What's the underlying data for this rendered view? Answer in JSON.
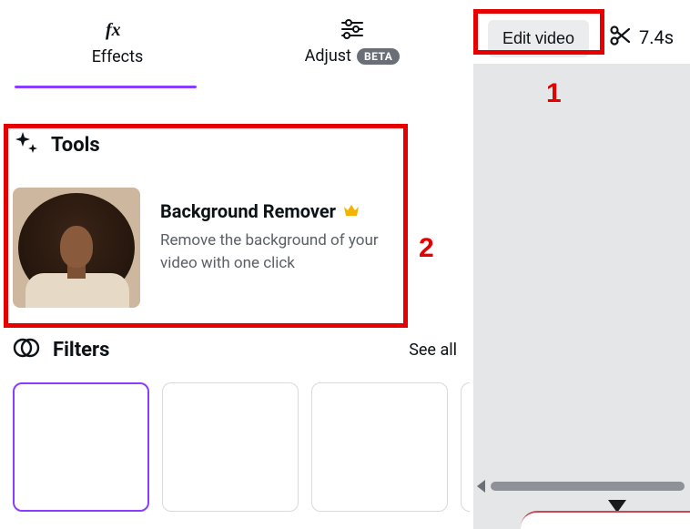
{
  "tabs": {
    "effects": {
      "label": "Effects"
    },
    "adjust": {
      "label": "Adjust",
      "badge": "BETA"
    }
  },
  "tools": {
    "section_title": "Tools",
    "bg_remover": {
      "title": "Background Remover",
      "desc": "Remove the background of your video with one click"
    }
  },
  "filters": {
    "section_title": "Filters",
    "see_all": "See all"
  },
  "editor": {
    "edit_video": "Edit video",
    "duration": "7.4s"
  },
  "annotations": {
    "n1": "1",
    "n2": "2"
  }
}
